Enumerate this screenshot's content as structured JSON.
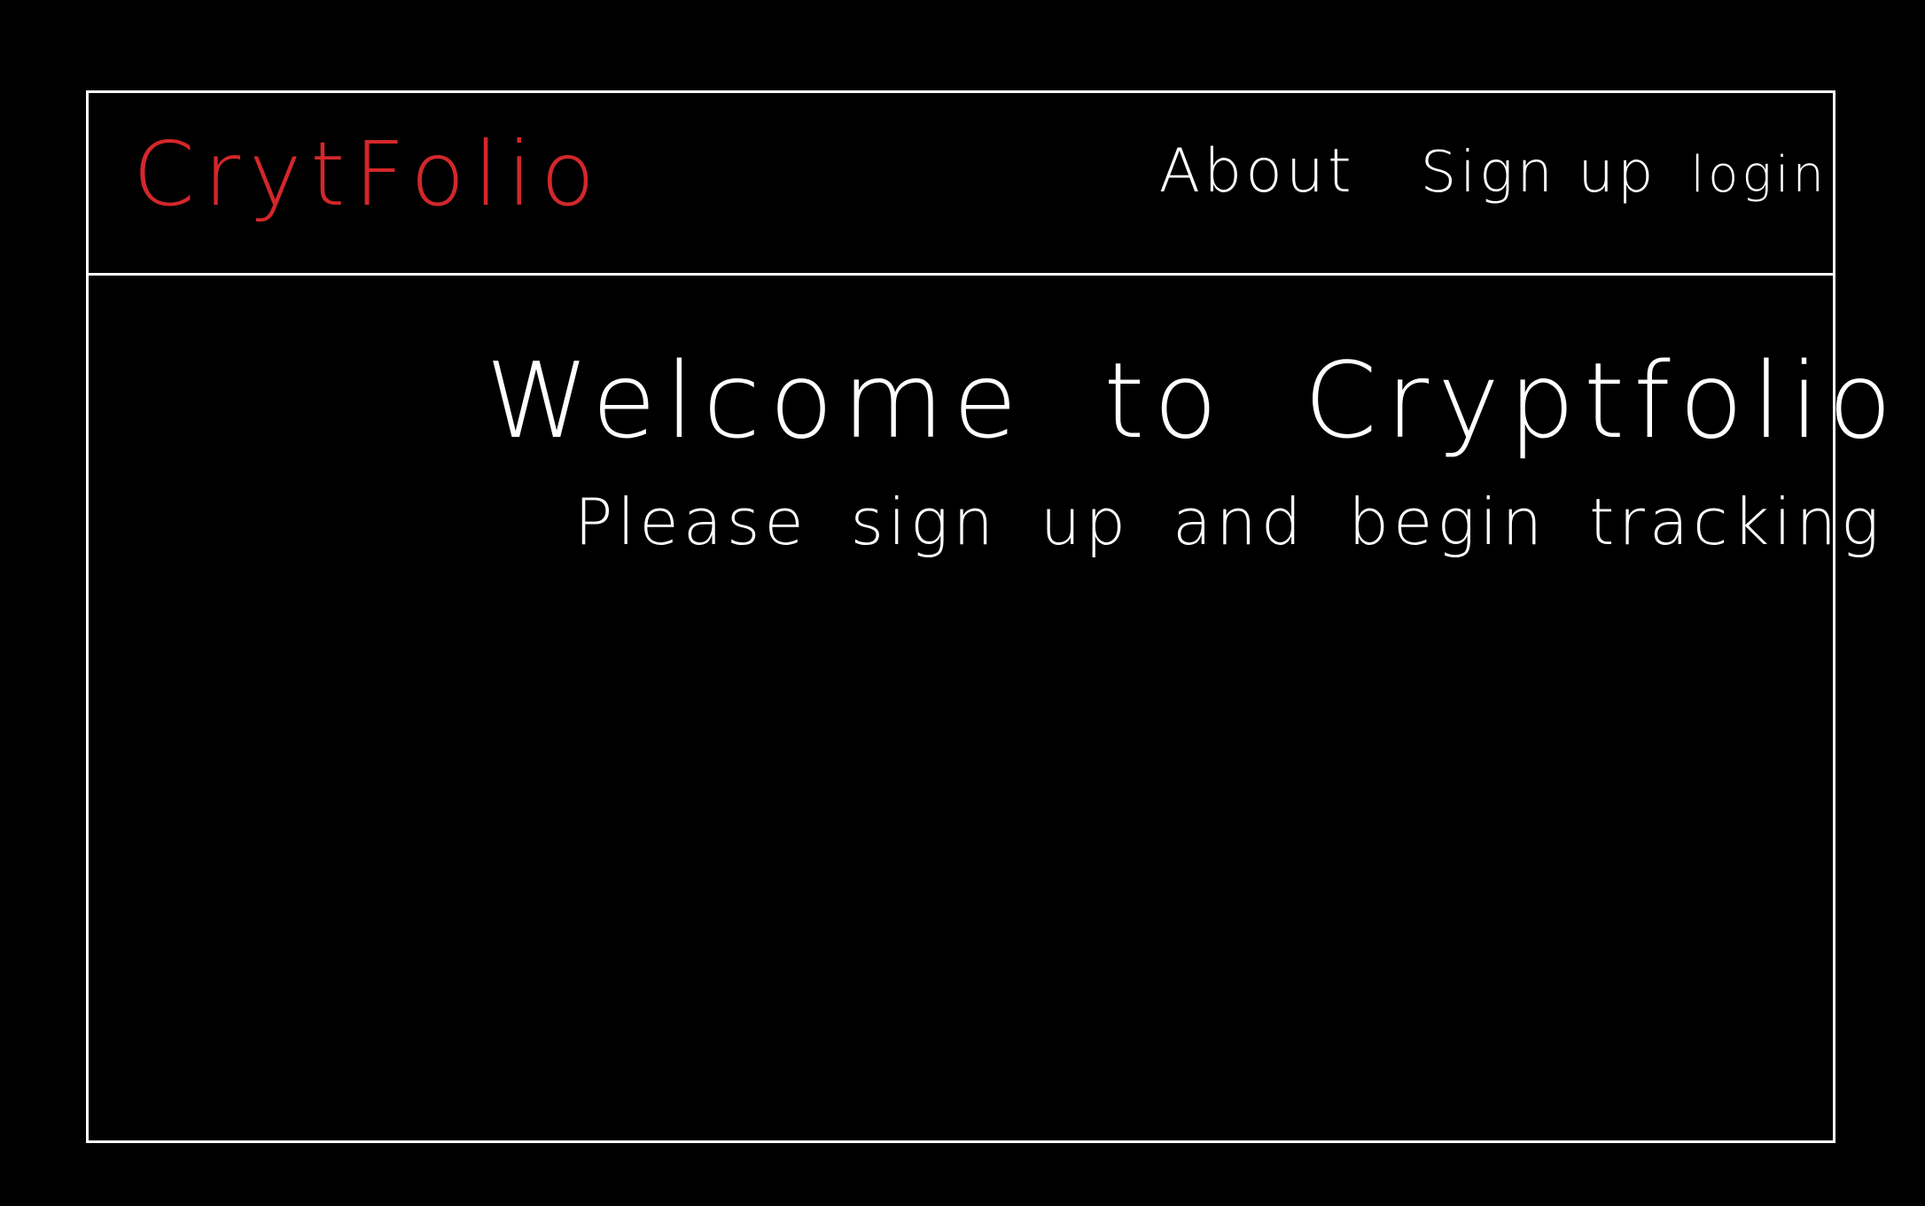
{
  "header": {
    "logo_text": "CrytFolio",
    "nav": {
      "about": "About",
      "signup": "Sign up",
      "login": "login"
    }
  },
  "hero": {
    "title": "Welcome to Cryptfolio",
    "subtitle": "Please sign up and begin tracking"
  },
  "colors": {
    "background": "#000000",
    "lines": "#ffffff",
    "logo": "#d3272b",
    "text": "#ffffff"
  }
}
